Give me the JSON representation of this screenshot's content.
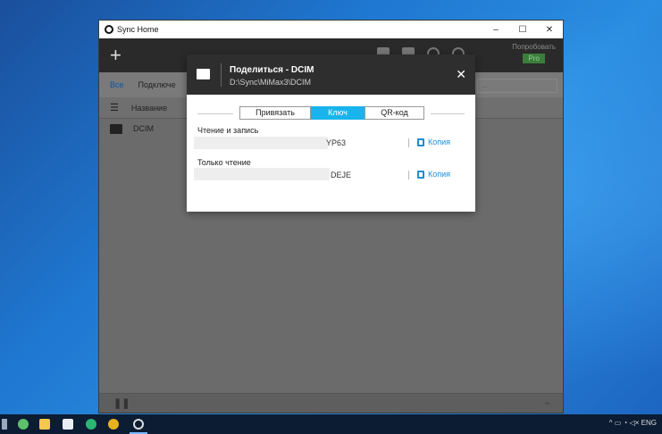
{
  "window": {
    "title": "Sync Home",
    "controls": {
      "minimize": "–",
      "maximize": "☐",
      "close": "✕"
    }
  },
  "toolbar": {
    "add_label": "+",
    "try_label": "Попробовать",
    "pro_label": "Pro"
  },
  "subnav": {
    "all": "Все",
    "connected": "Подключе"
  },
  "search": {
    "placeholder": "..."
  },
  "list": {
    "header": "Название",
    "items": [
      {
        "name": "DCIM"
      }
    ]
  },
  "dialog": {
    "title": "Поделиться - DCIM",
    "path": "D:\\Sync\\MiMax3\\DCIM",
    "close": "✕",
    "tabs": [
      "Привязать",
      "Ключ",
      "QR-код"
    ],
    "active_tab": "Ключ",
    "read_write": {
      "label": "Чтение и запись",
      "key_tail": "YP63",
      "copy": "Копия"
    },
    "read_only": {
      "label": "Только чтение",
      "key_tail": "DEJE",
      "copy": "Копия"
    }
  },
  "taskbar": {
    "tray_text": "^  ▭  ◔  ◁×  ENG"
  },
  "colors": {
    "accent": "#1ab4ec",
    "dialog_header": "#2e2e2e",
    "copy_link": "#1a8fd6"
  }
}
